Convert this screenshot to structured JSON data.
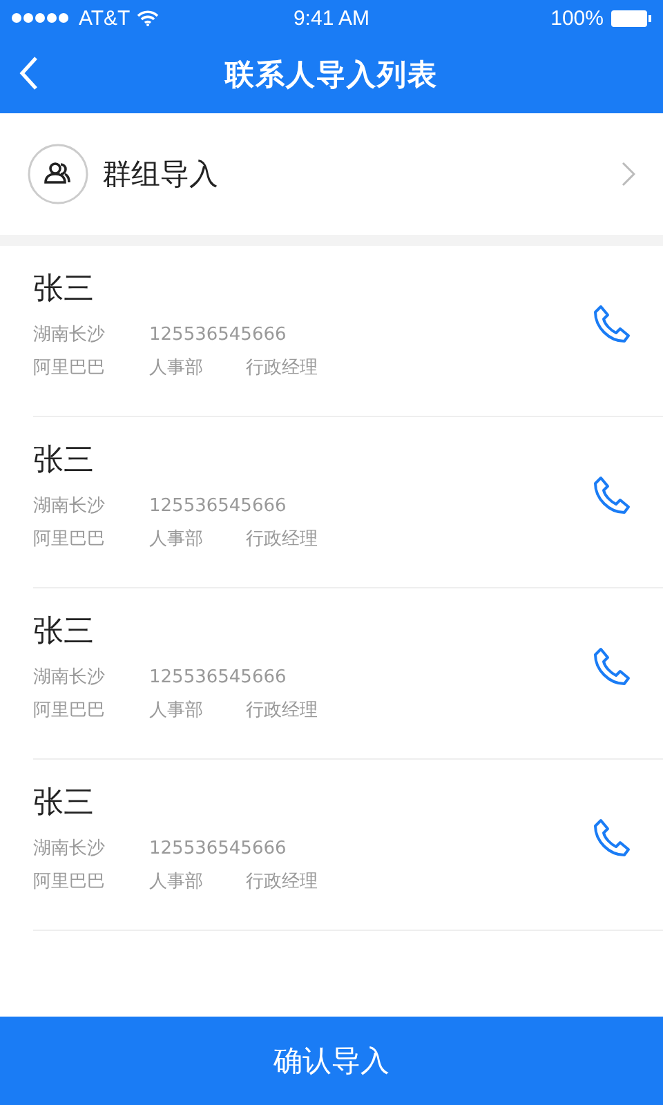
{
  "status_bar": {
    "carrier": "AT&T",
    "time": "9:41 AM",
    "battery": "100%"
  },
  "nav": {
    "title": "联系人导入列表"
  },
  "group_import": {
    "label": "群组导入"
  },
  "contacts": [
    {
      "name": "张三",
      "region": "湖南长沙",
      "phone": "125536545666",
      "company": "阿里巴巴",
      "department": "人事部",
      "position": "行政经理"
    },
    {
      "name": "张三",
      "region": "湖南长沙",
      "phone": "125536545666",
      "company": "阿里巴巴",
      "department": "人事部",
      "position": "行政经理"
    },
    {
      "name": "张三",
      "region": "湖南长沙",
      "phone": "125536545666",
      "company": "阿里巴巴",
      "department": "人事部",
      "position": "行政经理"
    },
    {
      "name": "张三",
      "region": "湖南长沙",
      "phone": "125536545666",
      "company": "阿里巴巴",
      "department": "人事部",
      "position": "行政经理"
    }
  ],
  "confirm_button": "确认导入"
}
